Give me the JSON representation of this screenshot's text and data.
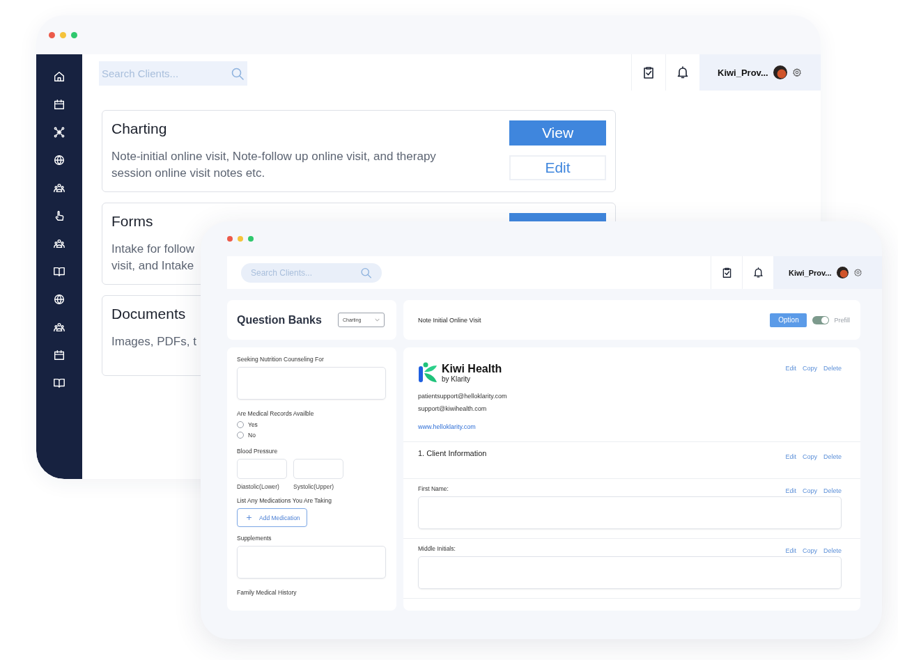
{
  "back_window": {
    "search": {
      "placeholder": "Search Clients..."
    },
    "user": {
      "name": "Kiwi_Prov..."
    },
    "cards": [
      {
        "title": "Charting",
        "description": "Note-initial online visit, Note-follow up online visit, and therapy session online visit notes etc.",
        "buttons": [
          {
            "kind": "primary",
            "label": "View"
          },
          {
            "kind": "outline",
            "label": "Edit"
          }
        ]
      },
      {
        "title": "Forms",
        "description": "Intake for follow\nvisit, and Intake",
        "buttons": [
          {
            "kind": "primary"
          }
        ]
      },
      {
        "title": "Documents",
        "description": "Images, PDFs, t"
      }
    ]
  },
  "front_window": {
    "search": {
      "placeholder": "Search Clients..."
    },
    "user": {
      "name": "Kiwi_Prov..."
    },
    "question_banks": {
      "title": "Question Banks",
      "dropdown": "Charting"
    },
    "form_fields": [
      {
        "kind": "textarea",
        "label": "Seeking Nutrition Counseling For"
      },
      {
        "kind": "radio",
        "label": "Are Medical Records Availble",
        "options": [
          {
            "label": "Yes",
            "selected": false
          },
          {
            "label": "No",
            "selected": false
          }
        ]
      },
      {
        "kind": "pair",
        "label": "Blood Pressure",
        "inputs": [
          {
            "caption": "Diastolic(Lower)"
          },
          {
            "caption": "Systolic(Upper)"
          }
        ]
      },
      {
        "kind": "add",
        "label": "List Any Medications You Are Taking",
        "button": "Add Medication"
      },
      {
        "kind": "textarea",
        "label": "Supplements"
      },
      {
        "kind": "label",
        "label": "Family Medical History"
      }
    ],
    "note": {
      "title": "Note Initial Online Visit",
      "option_button": "Option",
      "prefill": {
        "label": "Prefill",
        "on": true
      }
    },
    "brand": {
      "name": "Kiwi Health",
      "byline": "by Klarity",
      "emails": [
        "patientsupport@helloklarity.com",
        "support@kiwihealth.com"
      ],
      "website": "www.helloklarity.com",
      "actions": [
        "Edit",
        "Copy",
        "Delete"
      ]
    },
    "sections": [
      {
        "kind": "heading",
        "title": "1. Client Information",
        "actions": [
          "Edit",
          "Copy",
          "Delete"
        ]
      },
      {
        "kind": "input",
        "title": "First Name:",
        "actions": [
          "Edit",
          "Copy",
          "Delete"
        ]
      },
      {
        "kind": "input",
        "title": "Middle Initials:",
        "actions": [
          "Edit",
          "Copy",
          "Delete"
        ]
      }
    ]
  }
}
